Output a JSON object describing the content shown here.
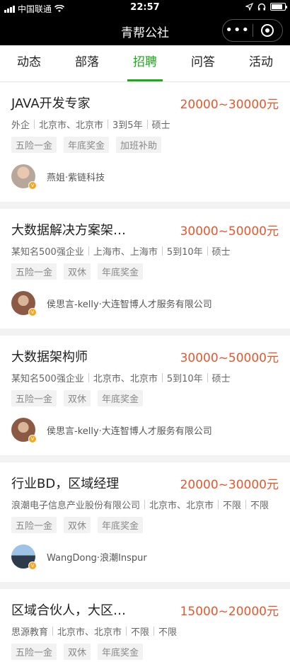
{
  "status": {
    "carrier": "中国联通",
    "time": "22:57"
  },
  "nav": {
    "title": "青帮公社",
    "more": "•••"
  },
  "tabs": [
    {
      "label": "动态"
    },
    {
      "label": "部落"
    },
    {
      "label": "招聘"
    },
    {
      "label": "问答"
    },
    {
      "label": "活动"
    }
  ],
  "active_tab": "招聘",
  "jobs": [
    {
      "title": "JAVA开发专家",
      "salary": "20000~30000元",
      "company": "外企",
      "location": "北京市、北京市",
      "experience": "3到5年",
      "education": "硕士",
      "tags": [
        "五险一金",
        "年底奖金",
        "加班补助"
      ],
      "poster": "燕姐·紫链科技",
      "avatar_color": "#b7a79a"
    },
    {
      "title": "大数据解决方案架…",
      "salary": "30000~50000元",
      "company": "某知名500强企业",
      "location": "上海市、上海市",
      "experience": "5到10年",
      "education": "硕士",
      "tags": [
        "五险一金",
        "双休",
        "年底奖金"
      ],
      "poster": "侯思言-kelly·大连智博人才服务有限公司",
      "avatar_color": "#8b5a44"
    },
    {
      "title": "大数据架构师",
      "salary": "30000~50000元",
      "company": "某知名500强企业",
      "location": "北京市、北京市",
      "experience": "5到10年",
      "education": "硕士",
      "tags": [
        "五险一金",
        "双休",
        "年底奖金"
      ],
      "poster": "侯思言-kelly·大连智博人才服务有限公司",
      "avatar_color": "#8b5a44"
    },
    {
      "title": "行业BD，区域经理",
      "salary": "20000~30000元",
      "company": "浪潮电子信息产业股份有限公司",
      "location": "北京市、北京市",
      "experience": "不限",
      "education": "不限",
      "tags": [
        "五险一金",
        "双休",
        "年底奖金"
      ],
      "poster": "WangDong·浪潮Inspur",
      "avatar_color": "#6f94b8"
    },
    {
      "title": "区域合伙人，大区…",
      "salary": "15000~20000元",
      "company": "思源教育",
      "location": "北京市、北京市",
      "experience": "不限",
      "education": "不限",
      "tags": [
        "五险一金",
        "双休",
        "年底奖金"
      ]
    }
  ],
  "colors": {
    "accent": "#1aad19",
    "salary": "#e6582c"
  }
}
